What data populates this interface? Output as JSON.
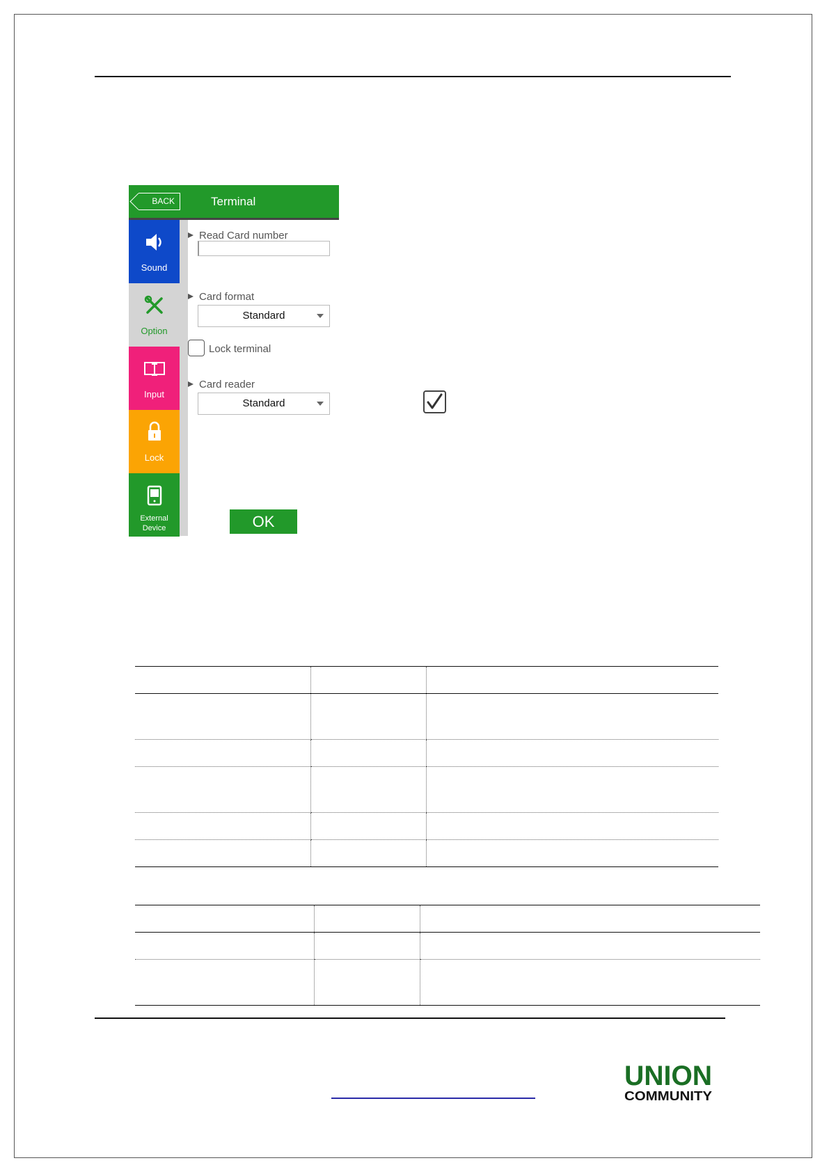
{
  "device": {
    "back_label": "BACK",
    "title": "Terminal",
    "sidebar": [
      {
        "label": "Sound",
        "color": "#0e49c9",
        "icon": "speaker-icon"
      },
      {
        "label": "Option",
        "color": "#d4d4d4",
        "icon": "wrench-icon"
      },
      {
        "label": "Input",
        "color": "#f0207a",
        "icon": "text-input-icon"
      },
      {
        "label": "Lock",
        "color": "#fba404",
        "icon": "padlock-icon"
      },
      {
        "label": "External\nDevice",
        "color": "#22992a",
        "icon": "terminal-device-icon"
      }
    ],
    "read_card_label": "Read Card number",
    "read_card_value": "",
    "card_format_label": "Card format",
    "card_format_value": "Standard",
    "lock_terminal_label": "Lock terminal",
    "lock_terminal_checked": false,
    "card_reader_label": "Card reader",
    "card_reader_value": "Standard",
    "ok_label": "OK"
  },
  "colors": {
    "header_green": "#22992a",
    "logo_green": "#1a6e24"
  },
  "logo": {
    "top_text": "UNION",
    "bottom_text": "COMMUNITY"
  }
}
